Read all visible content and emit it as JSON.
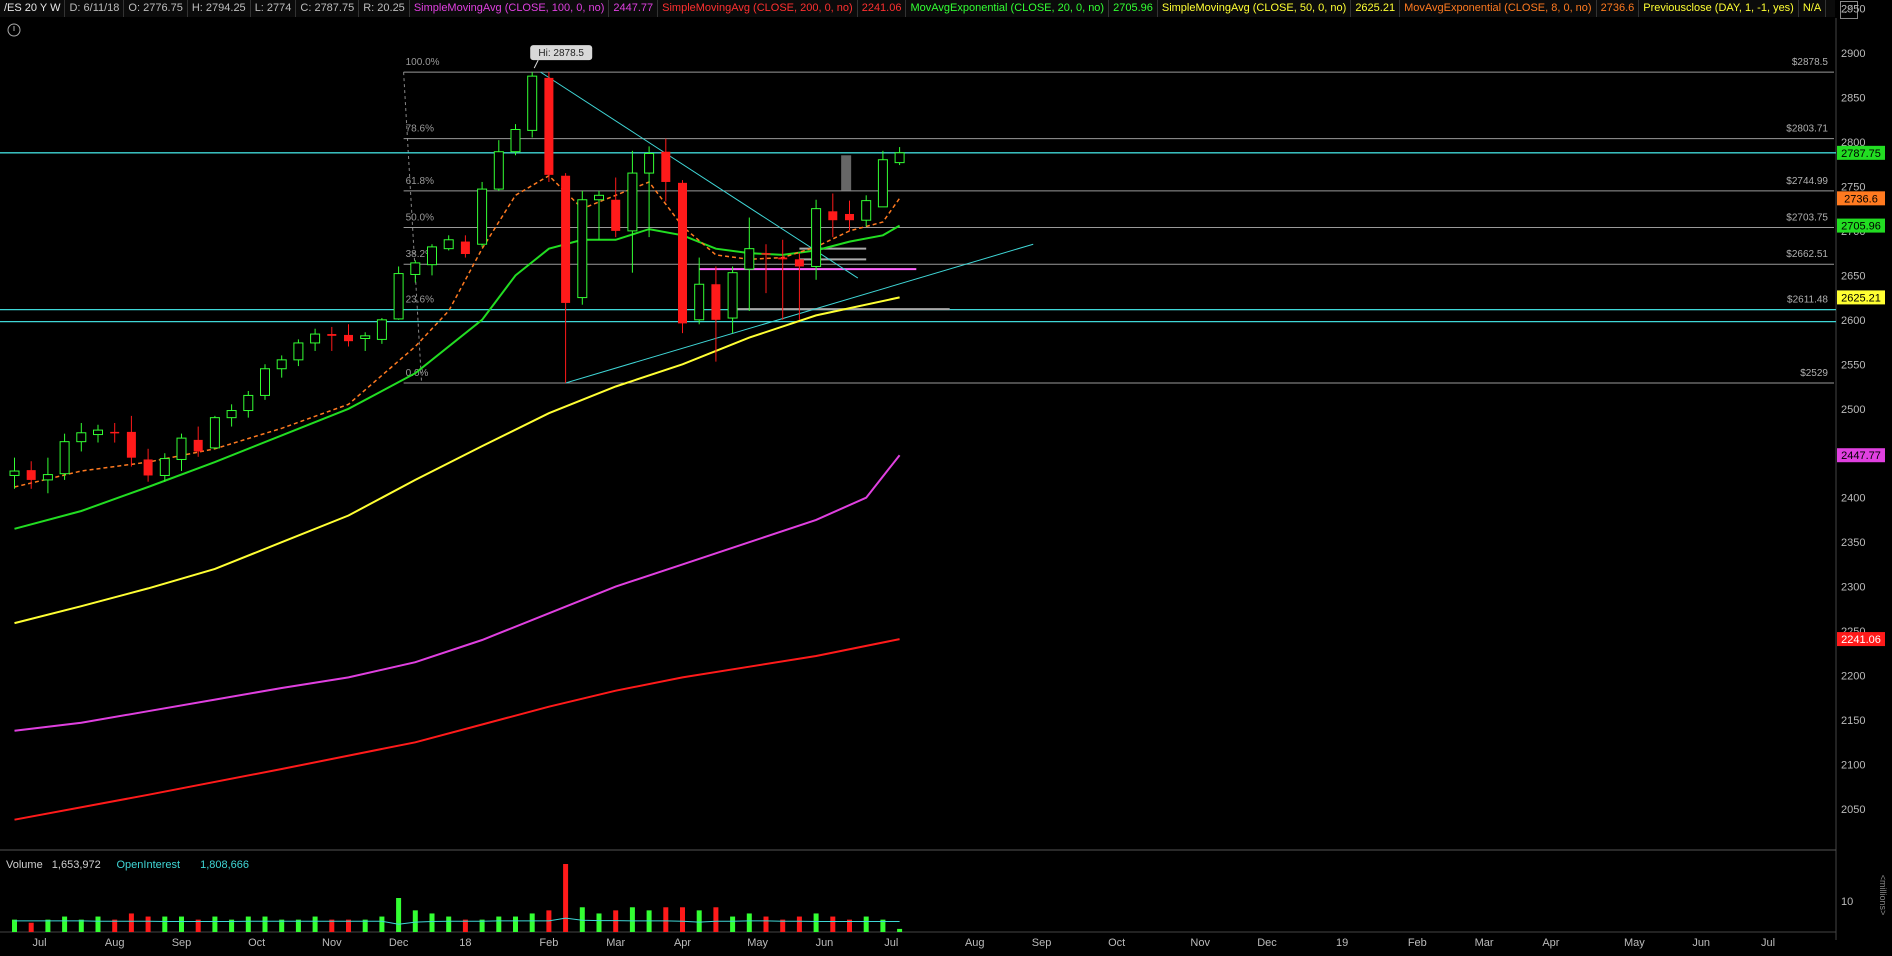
{
  "header": [
    {
      "key": "symbol",
      "text": "/ES 20 Y W",
      "color": "#e8e8e8"
    },
    {
      "key": "date",
      "text": "D: 6/11/18",
      "color": "#bdbdbd"
    },
    {
      "key": "open",
      "text": "O: 2776.75",
      "color": "#bdbdbd"
    },
    {
      "key": "high",
      "text": "H: 2794.25",
      "color": "#bdbdbd"
    },
    {
      "key": "low",
      "text": "L: 2774",
      "color": "#bdbdbd"
    },
    {
      "key": "close",
      "text": "C: 2787.75",
      "color": "#bdbdbd"
    },
    {
      "key": "range",
      "text": "R: 20.25",
      "color": "#bdbdbd"
    },
    {
      "key": "sma100",
      "text": "SimpleMovingAvg (CLOSE, 100, 0, no)",
      "color": "#e040e0"
    },
    {
      "key": "sma100-val",
      "text": "2447.77",
      "color": "#e040e0"
    },
    {
      "key": "sma200",
      "text": "SimpleMovingAvg (CLOSE, 200, 0, no)",
      "color": "#ff3030"
    },
    {
      "key": "sma200-val",
      "text": "2241.06",
      "color": "#ff3030"
    },
    {
      "key": "ema20",
      "text": "MovAvgExponential (CLOSE, 20, 0, no)",
      "color": "#33ff33"
    },
    {
      "key": "ema20-val",
      "text": "2705.96",
      "color": "#33ff33"
    },
    {
      "key": "sma50",
      "text": "SimpleMovingAvg (CLOSE, 50, 0, no)",
      "color": "#ffff33"
    },
    {
      "key": "sma50-val",
      "text": "2625.21",
      "color": "#ffff33"
    },
    {
      "key": "ema8",
      "text": "MovAvgExponential (CLOSE, 8, 0, no)",
      "color": "#ff7a20"
    },
    {
      "key": "ema8-val",
      "text": "2736.6",
      "color": "#ff7a20"
    },
    {
      "key": "prevclose",
      "text": "Previousclose (DAY, 1, -1, yes)",
      "color": "#ffff33"
    },
    {
      "key": "prevclose-val",
      "text": "N/A",
      "color": "#ffff33"
    }
  ],
  "volume_header": [
    {
      "key": "volume-label",
      "text": "Volume",
      "color": "#d0d0d0"
    },
    {
      "key": "volume-val",
      "text": "1,653,972",
      "color": "#d0d0d0"
    },
    {
      "key": "oi-label",
      "text": "OpenInterest",
      "color": "#3fd6d6"
    },
    {
      "key": "oi-val",
      "text": "1,808,666",
      "color": "#3fd6d6"
    }
  ],
  "chart_data": {
    "type": "candlestick",
    "timeframe": "weekly",
    "price_axis": {
      "ylim": [
        2010,
        2960
      ],
      "ticks": [
        2050,
        2100,
        2150,
        2200,
        2250,
        2300,
        2350,
        2400,
        2450,
        2500,
        2550,
        2600,
        2650,
        2700,
        2750,
        2800,
        2850,
        2900,
        2950
      ]
    },
    "x_ticks": [
      {
        "label": "Jul",
        "week": 1.5
      },
      {
        "label": "Aug",
        "week": 6
      },
      {
        "label": "Sep",
        "week": 10
      },
      {
        "label": "Oct",
        "week": 14.5
      },
      {
        "label": "Nov",
        "week": 19
      },
      {
        "label": "Dec",
        "week": 23
      },
      {
        "label": "18",
        "week": 27
      },
      {
        "label": "Feb",
        "week": 32
      },
      {
        "label": "Mar",
        "week": 36
      },
      {
        "label": "Apr",
        "week": 40
      },
      {
        "label": "May",
        "week": 44.5
      },
      {
        "label": "Jun",
        "week": 48.5
      },
      {
        "label": "Jul",
        "week": 52.5
      },
      {
        "label": "Aug",
        "week": 57.5
      },
      {
        "label": "Sep",
        "week": 61.5
      },
      {
        "label": "Oct",
        "week": 66
      },
      {
        "label": "Nov",
        "week": 71
      },
      {
        "label": "Dec",
        "week": 75
      },
      {
        "label": "19",
        "week": 79.5
      },
      {
        "label": "Feb",
        "week": 84
      },
      {
        "label": "Mar",
        "week": 88
      },
      {
        "label": "Apr",
        "week": 92
      },
      {
        "label": "May",
        "week": 97
      },
      {
        "label": "Jun",
        "week": 101
      },
      {
        "label": "Jul",
        "week": 105
      }
    ],
    "candles": [
      {
        "o": 2425,
        "h": 2445,
        "l": 2410,
        "c": 2430
      },
      {
        "o": 2431,
        "h": 2441,
        "l": 2410,
        "c": 2420
      },
      {
        "o": 2420,
        "h": 2445,
        "l": 2405,
        "c": 2426
      },
      {
        "o": 2427,
        "h": 2472,
        "l": 2420,
        "c": 2463
      },
      {
        "o": 2463,
        "h": 2484,
        "l": 2452,
        "c": 2473
      },
      {
        "o": 2471,
        "h": 2482,
        "l": 2462,
        "c": 2476
      },
      {
        "o": 2474,
        "h": 2484,
        "l": 2462,
        "c": 2473
      },
      {
        "o": 2474,
        "h": 2492,
        "l": 2435,
        "c": 2445
      },
      {
        "o": 2443,
        "h": 2455,
        "l": 2418,
        "c": 2425
      },
      {
        "o": 2425,
        "h": 2450,
        "l": 2418,
        "c": 2444
      },
      {
        "o": 2443,
        "h": 2472,
        "l": 2430,
        "c": 2467
      },
      {
        "o": 2465,
        "h": 2480,
        "l": 2446,
        "c": 2452
      },
      {
        "o": 2456,
        "h": 2492,
        "l": 2455,
        "c": 2490
      },
      {
        "o": 2490,
        "h": 2505,
        "l": 2480,
        "c": 2498
      },
      {
        "o": 2498,
        "h": 2520,
        "l": 2490,
        "c": 2515
      },
      {
        "o": 2515,
        "h": 2550,
        "l": 2510,
        "c": 2545
      },
      {
        "o": 2545,
        "h": 2560,
        "l": 2535,
        "c": 2555
      },
      {
        "o": 2555,
        "h": 2578,
        "l": 2548,
        "c": 2574
      },
      {
        "o": 2574,
        "h": 2590,
        "l": 2565,
        "c": 2584
      },
      {
        "o": 2584,
        "h": 2592,
        "l": 2565,
        "c": 2582
      },
      {
        "o": 2583,
        "h": 2595,
        "l": 2570,
        "c": 2576
      },
      {
        "o": 2579,
        "h": 2586,
        "l": 2565,
        "c": 2582
      },
      {
        "o": 2578,
        "h": 2602,
        "l": 2573,
        "c": 2600
      },
      {
        "o": 2601,
        "h": 2660,
        "l": 2600,
        "c": 2652
      },
      {
        "o": 2651,
        "h": 2667,
        "l": 2642,
        "c": 2664
      },
      {
        "o": 2662,
        "h": 2685,
        "l": 2650,
        "c": 2682
      },
      {
        "o": 2680,
        "h": 2695,
        "l": 2678,
        "c": 2690
      },
      {
        "o": 2688,
        "h": 2695,
        "l": 2670,
        "c": 2674
      },
      {
        "o": 2685,
        "h": 2755,
        "l": 2682,
        "c": 2747
      },
      {
        "o": 2747,
        "h": 2802,
        "l": 2745,
        "c": 2789
      },
      {
        "o": 2789,
        "h": 2820,
        "l": 2785,
        "c": 2814
      },
      {
        "o": 2813,
        "h": 2878.5,
        "l": 2805,
        "c": 2874
      },
      {
        "o": 2872,
        "h": 2878.5,
        "l": 2755,
        "c": 2763
      },
      {
        "o": 2762,
        "h": 2765,
        "l": 2529,
        "c": 2619
      },
      {
        "o": 2625,
        "h": 2745,
        "l": 2617,
        "c": 2735
      },
      {
        "o": 2735,
        "h": 2745,
        "l": 2690,
        "c": 2740
      },
      {
        "o": 2735,
        "h": 2760,
        "l": 2693,
        "c": 2700
      },
      {
        "o": 2700,
        "h": 2790,
        "l": 2653,
        "c": 2765
      },
      {
        "o": 2765,
        "h": 2795,
        "l": 2693,
        "c": 2787
      },
      {
        "o": 2789,
        "h": 2803.7,
        "l": 2733,
        "c": 2755
      },
      {
        "o": 2754,
        "h": 2757,
        "l": 2585,
        "c": 2596
      },
      {
        "o": 2600,
        "h": 2670,
        "l": 2595,
        "c": 2640
      },
      {
        "o": 2640,
        "h": 2660,
        "l": 2553,
        "c": 2600
      },
      {
        "o": 2602,
        "h": 2660,
        "l": 2585,
        "c": 2653
      },
      {
        "o": 2657,
        "h": 2715,
        "l": 2610,
        "c": 2680
      },
      {
        "o": 2675,
        "h": 2685,
        "l": 2630,
        "c": 2674
      },
      {
        "o": 2670,
        "h": 2690,
        "l": 2600,
        "c": 2668
      },
      {
        "o": 2668,
        "h": 2675,
        "l": 2600,
        "c": 2660
      },
      {
        "o": 2660,
        "h": 2735,
        "l": 2645,
        "c": 2725
      },
      {
        "o": 2722,
        "h": 2742,
        "l": 2693,
        "c": 2712
      },
      {
        "o": 2719,
        "h": 2734,
        "l": 2700,
        "c": 2712
      },
      {
        "o": 2712,
        "h": 2740,
        "l": 2705,
        "c": 2734
      },
      {
        "o": 2727,
        "h": 2790,
        "l": 2730,
        "c": 2780
      },
      {
        "o": 2776.75,
        "h": 2794.25,
        "l": 2774,
        "c": 2787.75
      }
    ],
    "moving_averages": [
      {
        "name": "SimpleMovingAvg (CLOSE, 100, 0, no)",
        "color": "#e040e0",
        "width": 2,
        "dash": "",
        "points": [
          [
            0,
            2138
          ],
          [
            4,
            2147
          ],
          [
            8,
            2160
          ],
          [
            12,
            2173
          ],
          [
            16,
            2186
          ],
          [
            20,
            2198
          ],
          [
            24,
            2215
          ],
          [
            28,
            2240
          ],
          [
            32,
            2270
          ],
          [
            36,
            2300
          ],
          [
            40,
            2325
          ],
          [
            44,
            2350
          ],
          [
            48,
            2375
          ],
          [
            51,
            2400
          ],
          [
            53,
            2447.77
          ]
        ]
      },
      {
        "name": "SimpleMovingAvg (CLOSE, 200, 0, no)",
        "color": "#ff1a1a",
        "width": 2,
        "dash": "",
        "points": [
          [
            0,
            2038
          ],
          [
            8,
            2066
          ],
          [
            16,
            2095
          ],
          [
            24,
            2125
          ],
          [
            28,
            2145
          ],
          [
            32,
            2165
          ],
          [
            36,
            2183
          ],
          [
            40,
            2198
          ],
          [
            44,
            2210
          ],
          [
            48,
            2222
          ],
          [
            53,
            2241.06
          ]
        ]
      },
      {
        "name": "SimpleMovingAvg (CLOSE, 50, 0, no)",
        "color": "#ffff33",
        "width": 2,
        "dash": "",
        "points": [
          [
            0,
            2259
          ],
          [
            4,
            2278
          ],
          [
            8,
            2298
          ],
          [
            12,
            2320
          ],
          [
            16,
            2350
          ],
          [
            20,
            2380
          ],
          [
            24,
            2420
          ],
          [
            28,
            2458
          ],
          [
            32,
            2495
          ],
          [
            36,
            2525
          ],
          [
            40,
            2550
          ],
          [
            44,
            2580
          ],
          [
            48,
            2605
          ],
          [
            53,
            2625.21
          ]
        ]
      },
      {
        "name": "MovAvgExponential (CLOSE, 20, 0, no)",
        "color": "#22dd22",
        "width": 2,
        "dash": "",
        "points": [
          [
            0,
            2365
          ],
          [
            4,
            2385
          ],
          [
            8,
            2412
          ],
          [
            12,
            2440
          ],
          [
            16,
            2470
          ],
          [
            20,
            2500
          ],
          [
            24,
            2540
          ],
          [
            28,
            2600
          ],
          [
            30,
            2650
          ],
          [
            32,
            2680
          ],
          [
            34,
            2690
          ],
          [
            36,
            2690
          ],
          [
            38,
            2702
          ],
          [
            40,
            2695
          ],
          [
            42,
            2680
          ],
          [
            44,
            2675
          ],
          [
            46,
            2673
          ],
          [
            48,
            2678
          ],
          [
            50,
            2688
          ],
          [
            52,
            2695
          ],
          [
            53,
            2705.96
          ]
        ]
      },
      {
        "name": "MovAvgExponential (CLOSE, 8, 0, no)",
        "color": "#ff7a20",
        "width": 1.5,
        "dash": "4,3",
        "points": [
          [
            0,
            2412
          ],
          [
            4,
            2430
          ],
          [
            8,
            2440
          ],
          [
            12,
            2455
          ],
          [
            16,
            2478
          ],
          [
            20,
            2505
          ],
          [
            24,
            2570
          ],
          [
            26,
            2610
          ],
          [
            28,
            2680
          ],
          [
            30,
            2740
          ],
          [
            32,
            2762
          ],
          [
            34,
            2725
          ],
          [
            36,
            2740
          ],
          [
            38,
            2755
          ],
          [
            40,
            2705
          ],
          [
            42,
            2673
          ],
          [
            44,
            2668
          ],
          [
            46,
            2670
          ],
          [
            48,
            2682
          ],
          [
            50,
            2700
          ],
          [
            52,
            2710
          ],
          [
            53,
            2736.6
          ]
        ]
      }
    ],
    "fibonacci": [
      {
        "pct": "100.0%",
        "price": 2878.5,
        "label": "$2878.5"
      },
      {
        "pct": "78.6%",
        "price": 2803.71,
        "label": "$2803.71"
      },
      {
        "pct": "61.8%",
        "price": 2744.99,
        "label": "$2744.99"
      },
      {
        "pct": "50.0%",
        "price": 2703.75,
        "label": "$2703.75"
      },
      {
        "pct": "38.2%",
        "price": 2662.51,
        "label": "$2662.51"
      },
      {
        "pct": "23.6%",
        "price": 2611.48,
        "label": "$2611.48"
      },
      {
        "pct": "0.0%",
        "price": 2529,
        "label": "$2529"
      }
    ],
    "fib_start_week": 23.3,
    "cyan_levels": [
      2787.75,
      2611.48,
      2598
    ],
    "price_labels": [
      {
        "text": "2787.75",
        "price": 2787.75,
        "bg": "#22dd22",
        "fg": "#000000"
      },
      {
        "text": "2736.6",
        "price": 2736.6,
        "bg": "#ff7a20",
        "fg": "#000000"
      },
      {
        "text": "2705.96",
        "price": 2705.96,
        "bg": "#22dd22",
        "fg": "#000000"
      },
      {
        "text": "2625.21",
        "price": 2625.21,
        "bg": "#ffff33",
        "fg": "#000000"
      },
      {
        "text": "2447.77",
        "price": 2447.77,
        "bg": "#e040e0",
        "fg": "#000000"
      },
      {
        "text": "2241.06",
        "price": 2241.06,
        "bg": "#ff1a1a",
        "fg": "#ffffff"
      }
    ],
    "hi_label": "Hi: 2878.5",
    "trendlines": [
      {
        "color": "#3fd6d6",
        "from": [
          31.5,
          2878.5
        ],
        "to": [
          50.5,
          2647
        ]
      },
      {
        "color": "#3fd6d6",
        "from": [
          33,
          2529
        ],
        "to": [
          61,
          2685
        ]
      }
    ],
    "zones": [
      {
        "color": "#ff66ff",
        "from": [
          41,
          2657
        ],
        "to": [
          54,
          2657
        ]
      },
      {
        "color": "#aaaaaa",
        "from": [
          43,
          2612
        ],
        "to": [
          56,
          2612
        ]
      },
      {
        "color": "#aaaaaa",
        "from": [
          47,
          2680
        ],
        "to": [
          51,
          2680
        ]
      },
      {
        "color": "#aaaaaa",
        "from": [
          47,
          2668
        ],
        "to": [
          51,
          2668
        ]
      }
    ],
    "volume": {
      "axis_ticks": [
        10
      ],
      "axis_unit": "<millions>",
      "ylim": [
        0,
        20
      ],
      "bars": [
        4,
        3,
        4,
        5,
        4,
        5,
        4,
        6,
        5,
        5,
        5,
        4,
        5,
        4,
        5,
        5,
        4,
        4,
        5,
        4,
        4,
        4,
        5,
        11,
        7,
        6,
        5,
        4,
        4,
        5,
        5,
        6,
        7,
        22,
        8,
        6,
        7,
        8,
        7,
        8,
        8,
        7,
        8,
        5,
        6,
        5,
        4,
        5,
        6,
        5,
        4,
        5,
        4,
        1
      ],
      "oi_line": [
        3.6,
        3.6,
        3.6,
        3.6,
        3.6,
        3.5,
        3.5,
        3.5,
        3.5,
        3.4,
        3.4,
        3.4,
        3.4,
        3.4,
        3.5,
        3.5,
        3.5,
        3.5,
        3.5,
        3.5,
        3.5,
        3.5,
        3.5,
        2.5,
        3.2,
        3.4,
        3.5,
        3.5,
        3.5,
        3.6,
        3.6,
        3.6,
        3.6,
        4.5,
        3.8,
        3.7,
        3.7,
        3.6,
        3.6,
        3.6,
        3.5,
        3.2,
        3.5,
        3.5,
        3.6,
        3.6,
        3.5,
        3.5,
        3.4,
        3.4,
        3.4,
        3.4,
        3.4,
        3.4
      ]
    }
  }
}
